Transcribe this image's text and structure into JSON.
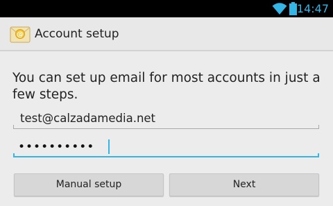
{
  "status_bar": {
    "time": "14:47",
    "wifi_icon": "wifi-icon",
    "battery_icon": "battery-icon",
    "accent_color": "#33b5e5"
  },
  "action_bar": {
    "icon": "email-app-icon",
    "title": "Account setup"
  },
  "form": {
    "instructions": "You can set up email for most accounts in just a few steps.",
    "email_value": "test@calzadamedia.net",
    "password_masked": "••••••••••"
  },
  "buttons": {
    "manual_setup": "Manual setup",
    "next": "Next"
  }
}
